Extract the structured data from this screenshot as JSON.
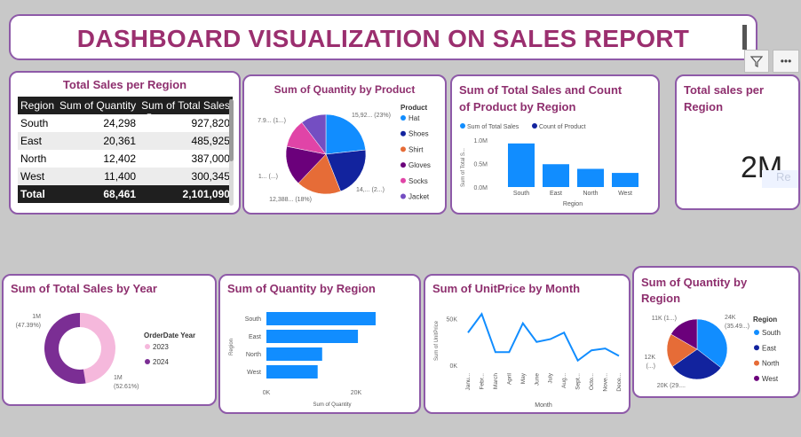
{
  "header": {
    "title": "DASHBOARD VISUALIZATION ON SALES REPORT"
  },
  "toolbar": {
    "filter_icon": "filter-icon",
    "more_label": "•••"
  },
  "table_card": {
    "title": "Total Sales per Region",
    "columns": [
      "Region",
      "Sum of Quantity",
      "Sum of Total Sales"
    ],
    "sort_indicator": "▼",
    "rows": [
      [
        "South",
        "24,298",
        "927,820"
      ],
      [
        "East",
        "20,361",
        "485,925"
      ],
      [
        "North",
        "12,402",
        "387,000"
      ],
      [
        "West",
        "11,400",
        "300,345"
      ]
    ],
    "total": [
      "Total",
      "68,461",
      "2,101,090"
    ]
  },
  "qty_product": {
    "title": "Sum of Quantity by Product",
    "legend_title": "Product",
    "slice_labels": [
      "15,92... (23%)",
      "14,... (2...)",
      "12,388... (18%)",
      "1... (...)",
      "7.9... (1...)"
    ],
    "legend": [
      "Hat",
      "Shoes",
      "Shirt",
      "Gloves",
      "Socks",
      "Jacket"
    ],
    "colors": [
      "#118dff",
      "#12239e",
      "#e66c37",
      "#6b007b",
      "#e044a7",
      "#744ec2"
    ]
  },
  "sales_count": {
    "title": "Sum of Total Sales and Count of Product by Region",
    "title_line1": "Sum of Total Sales and Count",
    "title_line2": "of Product by Region",
    "legend": [
      "Sum of Total Sales",
      "Count of Product"
    ],
    "y_ticks": [
      "1.0M",
      "0.5M",
      "0.0M"
    ],
    "ylabel": "Sum of Total S...",
    "xlabel": "Region"
  },
  "total_card": {
    "title": "Total sales per Region",
    "title_line1": "Total sales per",
    "title_line2": "Region",
    "value": "2M",
    "ghost_text": "Re"
  },
  "sales_year": {
    "title": "Sum of Total Sales by Year",
    "legend_title": "OrderDate Year",
    "legend": [
      "2023",
      "2024"
    ],
    "label_a_1": "1M",
    "label_a_2": "(47.39%)",
    "label_b_1": "1M",
    "label_b_2": "(52.61%)"
  },
  "qty_region": {
    "title": "Sum of Quantity by Region",
    "ylabel": "Region",
    "xlabel": "Sum of Quantity",
    "x_ticks": [
      "0K",
      "20K"
    ]
  },
  "unitprice_month": {
    "title": "Sum of UnitPrice by Month",
    "ylabel": "Sum of UnitPrice",
    "xlabel": "Month",
    "y_ticks": [
      "50K",
      "0K"
    ]
  },
  "qty_region_pie": {
    "title": "Sum of Quantity by Region",
    "title_line1": "Sum of Quantity by",
    "title_line2": "Region",
    "legend_title": "Region",
    "legend": [
      "South",
      "East",
      "North",
      "West"
    ],
    "labels": [
      "11K (1...)",
      "24K",
      "(35.49...)",
      "12K",
      "(...)",
      "20K (29...."
    ]
  },
  "chart_data": [
    {
      "type": "pie",
      "title": "Sum of Quantity by Product",
      "categories": [
        "Hat",
        "Shoes",
        "Shirt",
        "Gloves",
        "Socks",
        "Jacket"
      ],
      "values": [
        15920,
        14200,
        12388,
        11000,
        7900,
        7053
      ]
    },
    {
      "type": "bar",
      "title": "Sum of Total Sales and Count of Product by Region",
      "categories": [
        "South",
        "East",
        "North",
        "West"
      ],
      "series": [
        {
          "name": "Sum of Total Sales",
          "values": [
            927820,
            485925,
            387000,
            300345
          ]
        },
        {
          "name": "Count of Product",
          "values": [
            0,
            0,
            0,
            0
          ]
        }
      ],
      "xlabel": "Region",
      "ylabel": "Sum of Total S...",
      "ylim": [
        0,
        1000000
      ]
    },
    {
      "type": "pie",
      "title": "Sum of Total Sales by Year",
      "categories": [
        "2023",
        "2024"
      ],
      "values": [
        47.39,
        52.61
      ]
    },
    {
      "type": "bar",
      "title": "Sum of Quantity by Region",
      "categories": [
        "South",
        "East",
        "North",
        "West"
      ],
      "values": [
        24298,
        20361,
        12402,
        11400
      ],
      "xlabel": "Sum of Quantity",
      "ylabel": "Region",
      "xlim": [
        0,
        25000
      ]
    },
    {
      "type": "line",
      "title": "Sum of UnitPrice by Month",
      "categories": [
        "Janu...",
        "Febr...",
        "March",
        "April",
        "May",
        "June",
        "July",
        "Aug...",
        "Sept...",
        "Octo...",
        "Nove...",
        "Dece..."
      ],
      "values": [
        35000,
        55000,
        14000,
        14000,
        45000,
        25000,
        28000,
        35000,
        5000,
        16000,
        18000,
        10000
      ],
      "xlabel": "Month",
      "ylabel": "Sum of UnitPrice",
      "ylim": [
        0,
        60000
      ]
    },
    {
      "type": "pie",
      "title": "Sum of Quantity by Region",
      "categories": [
        "South",
        "East",
        "North",
        "West"
      ],
      "values": [
        24298,
        20361,
        12402,
        11400
      ]
    }
  ]
}
